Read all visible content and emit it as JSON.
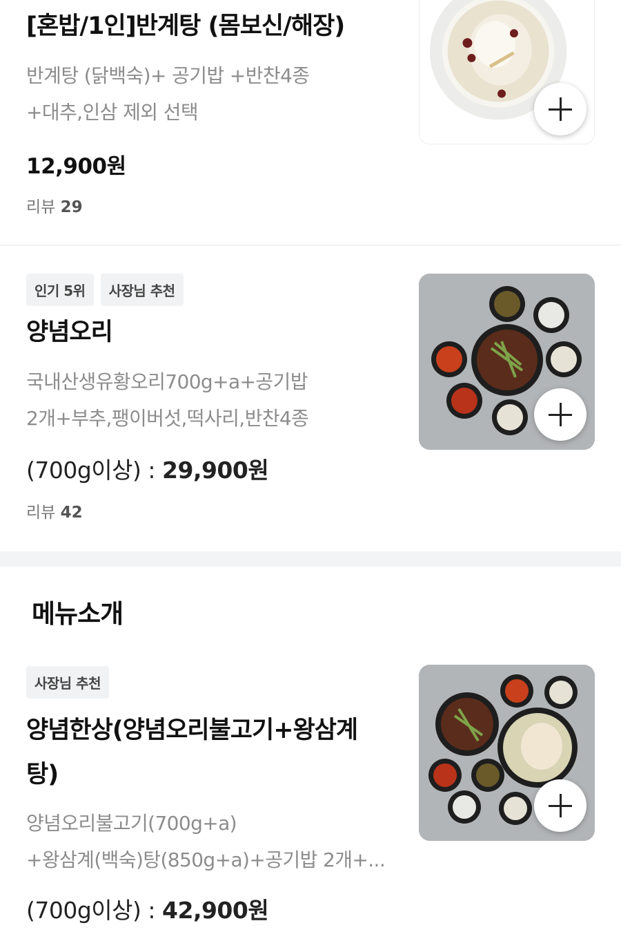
{
  "items": [
    {
      "title": "[혼밥/1인]반계탕 (몸보신/해장)",
      "desc_line1": "반계탕 (닭백숙)+ 공기밥 +반찬4종",
      "desc_line2": "+대추,인삼 제외 선택",
      "price": "12,900원",
      "review_label": "리뷰",
      "review_count": "29"
    },
    {
      "badges": [
        "인기 5위",
        "사장님 추천"
      ],
      "title": "양념오리",
      "desc_line1": "국내산생유황오리700g+a+공기밥",
      "desc_line2": "2개+부추,팽이버섯,떡사리,반찬4종",
      "price_prefix": "(700g이상) : ",
      "price": "29,900원",
      "review_label": "리뷰",
      "review_count": "42"
    }
  ],
  "section": {
    "title": "메뉴소개",
    "item": {
      "badge": "사장님 추천",
      "title_line1": "양념한상(양념오리불고기+왕삼계",
      "title_line2": "탕)",
      "desc_line1": "양념오리불고기(700g+a)",
      "desc_line2": "+왕삼계(백숙)탕(850g+a)+공기밥 2개+...",
      "price_prefix": "(700g이상) : ",
      "price": "42,900원"
    }
  },
  "icons": {
    "add": "plus-icon"
  },
  "colors": {
    "text_primary": "#111111",
    "text_secondary": "#8c8c8c",
    "badge_bg": "#f1f2f3",
    "divider": "#f3f4f6"
  }
}
